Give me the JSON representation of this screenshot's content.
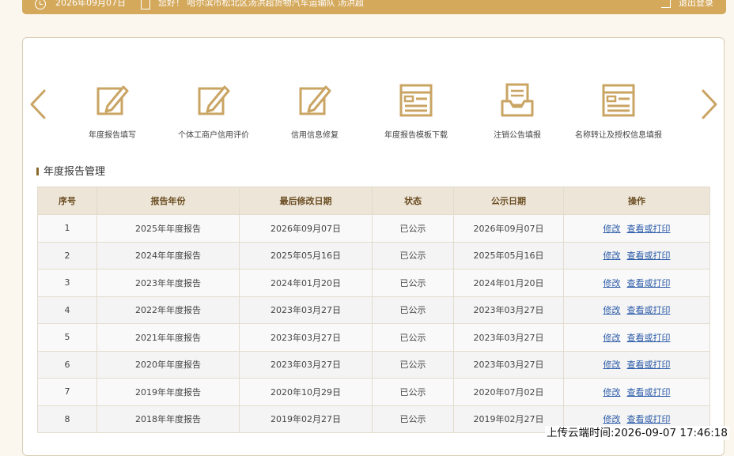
{
  "topbar": {
    "date": "2026年09月07日",
    "greeting": "您好！ 哈尔滨市松北区汤洪超货物汽车运输队   汤洪超",
    "logout": "退出登录"
  },
  "shortcuts": [
    {
      "label": "年度报告填写",
      "icon": "edit-doc-icon"
    },
    {
      "label": "个体工商户信用评价",
      "icon": "edit-doc-icon"
    },
    {
      "label": "信用信息修复",
      "icon": "edit-doc-icon"
    },
    {
      "label": "年度报告模板下载",
      "icon": "web-template-icon"
    },
    {
      "label": "注销公告填报",
      "icon": "inbox-doc-icon"
    },
    {
      "label": "名称转让及授权信息填报",
      "icon": "web-template-icon"
    }
  ],
  "section_title": "年度报告管理",
  "table": {
    "headers": [
      "序号",
      "报告年份",
      "最后修改日期",
      "状态",
      "公示日期",
      "操作"
    ],
    "action_edit": "修改",
    "action_view": "查看或打印",
    "rows": [
      {
        "no": "1",
        "year": "2025年年度报告",
        "modified": "2026年09月07日",
        "status": "已公示",
        "published": "2026年09月07日"
      },
      {
        "no": "2",
        "year": "2024年年度报告",
        "modified": "2025年05月16日",
        "status": "已公示",
        "published": "2025年05月16日"
      },
      {
        "no": "3",
        "year": "2023年年度报告",
        "modified": "2024年01月20日",
        "status": "已公示",
        "published": "2024年01月20日"
      },
      {
        "no": "4",
        "year": "2022年年度报告",
        "modified": "2023年03月27日",
        "status": "已公示",
        "published": "2023年03月27日"
      },
      {
        "no": "5",
        "year": "2021年年度报告",
        "modified": "2023年03月27日",
        "status": "已公示",
        "published": "2023年03月27日"
      },
      {
        "no": "6",
        "year": "2020年年度报告",
        "modified": "2023年03月27日",
        "status": "已公示",
        "published": "2023年03月27日"
      },
      {
        "no": "7",
        "year": "2019年年度报告",
        "modified": "2020年10月29日",
        "status": "已公示",
        "published": "2020年07月02日"
      },
      {
        "no": "8",
        "year": "2018年年度报告",
        "modified": "2019年02月27日",
        "status": "已公示",
        "published": "2019年02月27日"
      }
    ]
  },
  "watermark": "上传云端时间:2026-09-07 17:46:18",
  "colors": {
    "accent": "#d4a95c",
    "header_bg": "#ede5d8",
    "link": "#2a5aa8"
  }
}
